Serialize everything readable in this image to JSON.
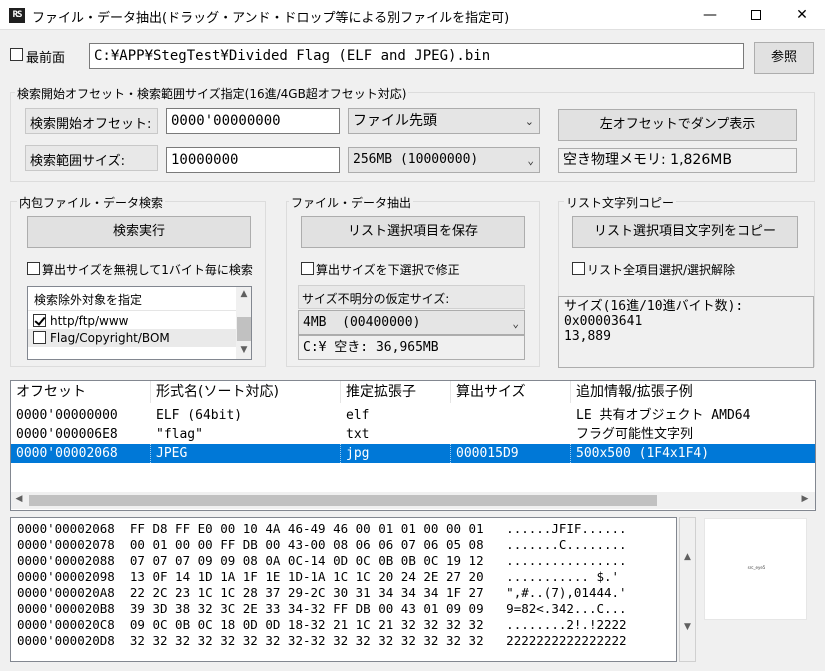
{
  "window": {
    "title": "ファイル・データ抽出(ドラッグ・アンド・ドロップ等による別ファイルを指定可)",
    "app_icon_text": "RS"
  },
  "top": {
    "always_on_top_label": "最前面",
    "file_path": "C:¥APP¥StegTest¥Divided Flag (ELF and JPEG).bin",
    "browse_label": "参照"
  },
  "search_range": {
    "group_title": "検索開始オフセット・検索範囲サイズ指定(16進/4GB超オフセット対応)",
    "start_offset_label": "検索開始オフセット:",
    "start_offset_value": "0000'00000000",
    "start_origin_option": "ファイル先頭",
    "dump_button_label": "左オフセットでダンプ表示",
    "range_size_label": "検索範囲サイズ:",
    "range_size_value": "10000000",
    "range_size_option": "256MB (10000000)",
    "free_memory_text": "空き物理メモリ: 1,826MB"
  },
  "embedded_search": {
    "group_title": "内包ファイル・データ検索",
    "run_button_label": "検索実行",
    "ignore_size_label": "算出サイズを無視して1バイト毎に検索",
    "exclude_list_title": "検索除外対象を指定",
    "exclude_items": [
      {
        "label": "http/ftp/www",
        "checked": true
      },
      {
        "label": "Flag/Copyright/BOM",
        "checked": false
      }
    ]
  },
  "extract": {
    "group_title": "ファイル・データ抽出",
    "save_button_label": "リスト選択項目を保存",
    "fix_size_label": "算出サイズを下選択で修正",
    "unknown_size_label": "サイズ不明分の仮定サイズ:",
    "unknown_size_option": "4MB  (00400000)",
    "drive_free_text": "C:¥  空き: 36,965MB"
  },
  "list_copy": {
    "group_title": "リスト文字列コピー",
    "copy_button_label": "リスト選択項目文字列をコピー",
    "select_all_label": "リスト全項目選択/選択解除",
    "size_info_lines": [
      "サイズ(16進/10進バイト数):",
      "0x00003641",
      "13,889"
    ]
  },
  "result_list": {
    "columns": [
      "オフセット",
      "形式名(ソート対応)",
      "推定拡張子",
      "算出サイズ",
      "追加情報/拡張子例"
    ],
    "rows": [
      {
        "offset": "0000'00000000",
        "format": "ELF (64bit)",
        "ext": "elf",
        "size": "",
        "info": "LE 共有オブジェクト AMD64",
        "selected": false
      },
      {
        "offset": "0000'000006E8",
        "format": "\"flag\"",
        "ext": "txt",
        "size": "",
        "info": "フラグ可能性文字列",
        "selected": false
      },
      {
        "offset": "0000'00002068",
        "format": "JPEG",
        "ext": "jpg",
        "size": "000015D9",
        "info": "500x500 (1F4x1F4)",
        "selected": true
      }
    ]
  },
  "hexdump": {
    "lines": [
      "0000'00002068  FF D8 FF E0 00 10 4A 46-49 46 00 01 01 00 00 01   ......JFIF......",
      "0000'00002078  00 01 00 00 FF DB 00 43-00 08 06 06 07 06 05 08   .......C........",
      "0000'00002088  07 07 07 09 09 08 0A 0C-14 0D 0C 0B 0B 0C 19 12   ................",
      "0000'00002098  13 0F 14 1D 1A 1F 1E 1D-1A 1C 1C 20 24 2E 27 20   ........... $.'",
      "0000'000020A8  22 2C 23 1C 1C 28 37 29-2C 30 31 34 34 34 1F 27   \",#..(7),01444.'",
      "0000'000020B8  39 3D 38 32 3C 2E 33 34-32 FF DB 00 43 01 09 09   9=82<.342...C...",
      "0000'000020C8  09 0C 0B 0C 18 0D 0D 18-32 21 1C 21 32 32 32 32   ........2!.!2222",
      "0000'000020D8  32 32 32 32 32 32 32 32-32 32 32 32 32 32 32 32   2222222222222222"
    ]
  },
  "preview": {
    "caption": "src_eye5"
  }
}
